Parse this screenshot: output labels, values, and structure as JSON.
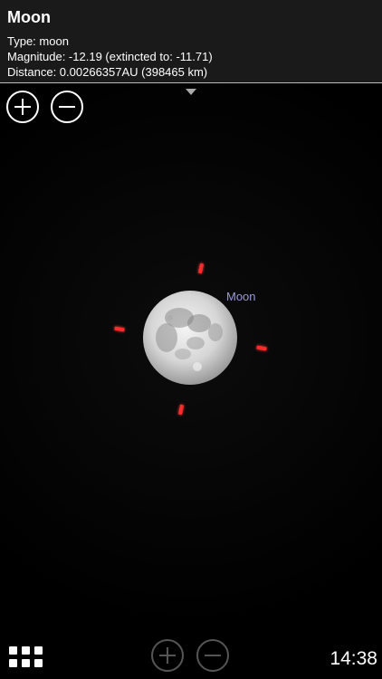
{
  "info": {
    "title": "Moon",
    "type_line": "Type: moon",
    "magnitude_line": "Magnitude: -12.19 (extincted to: -11.71)",
    "distance_line": "Distance: 0.00266357AU (398465 km)"
  },
  "sky": {
    "object_label": "Moon"
  },
  "status": {
    "time": "14:38"
  },
  "icons": {
    "zoom_in": "plus-circle-icon",
    "zoom_out": "minus-circle-icon",
    "menu": "grid-menu-icon",
    "collapse": "triangle-down-icon"
  },
  "colors": {
    "panel_bg": "#1a1a1a",
    "pointer": "#ff2a2a",
    "label": "#9a9ad8"
  }
}
